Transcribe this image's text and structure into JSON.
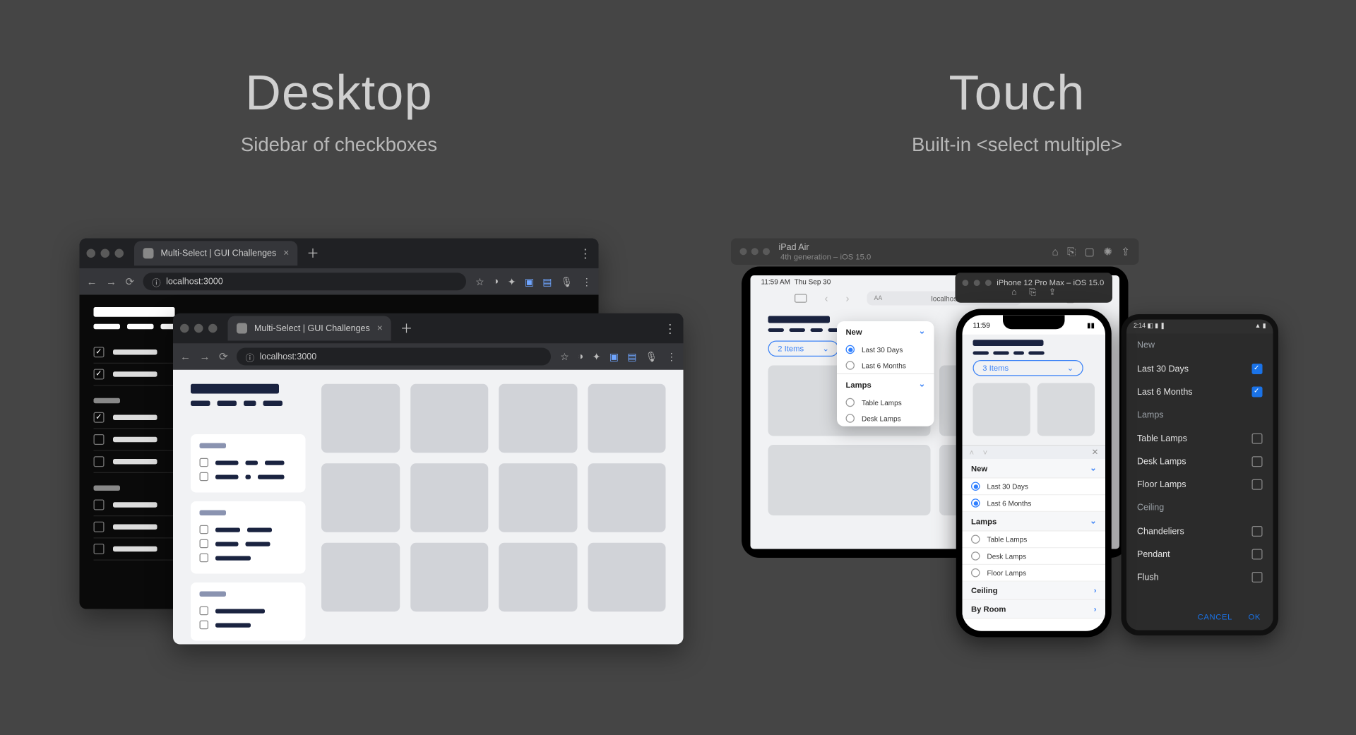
{
  "headings": {
    "desktop_title": "Desktop",
    "desktop_sub": "Sidebar of checkboxes",
    "touch_title": "Touch",
    "touch_sub": "Built-in <select multiple>"
  },
  "browser": {
    "tab_title": "Multi-Select | GUI Challenges",
    "url": "localhost:3000"
  },
  "simulator": {
    "ipad_name": "iPad Air",
    "ipad_sub": "4th generation – iOS 15.0",
    "iphone_name": "iPhone 12 Pro Max – iOS 15.0"
  },
  "ipad": {
    "status_time": "11:59 AM",
    "status_date": "Thu Sep 30",
    "safari_url": "localhost",
    "pill_text": "2 Items",
    "popover": {
      "sec1": "New",
      "sec1_rows": [
        "Last 30 Days",
        "Last 6 Months"
      ],
      "sec2": "Lamps",
      "sec2_rows": [
        "Table Lamps",
        "Desk Lamps"
      ]
    }
  },
  "iphone": {
    "status_time": "11:59",
    "pill_text": "3 Items",
    "list": {
      "sec1": "New",
      "sec1_rows": [
        "Last 30 Days",
        "Last 6 Months"
      ],
      "sec2": "Lamps",
      "sec2_rows": [
        "Table Lamps",
        "Desk Lamps",
        "Floor Lamps"
      ],
      "sec3": "Ceiling",
      "sec4": "By Room"
    }
  },
  "android": {
    "status_time": "2:14",
    "groups": [
      {
        "header": "New",
        "rows": [
          {
            "label": "Last 30 Days",
            "on": true
          },
          {
            "label": "Last 6 Months",
            "on": true
          }
        ]
      },
      {
        "header": "Lamps",
        "rows": [
          {
            "label": "Table Lamps",
            "on": false
          },
          {
            "label": "Desk Lamps",
            "on": false
          },
          {
            "label": "Floor Lamps",
            "on": false
          }
        ]
      },
      {
        "header": "Ceiling",
        "rows": [
          {
            "label": "Chandeliers",
            "on": false
          },
          {
            "label": "Pendant",
            "on": false
          },
          {
            "label": "Flush",
            "on": false
          }
        ]
      }
    ],
    "cancel": "CANCEL",
    "ok": "OK"
  }
}
